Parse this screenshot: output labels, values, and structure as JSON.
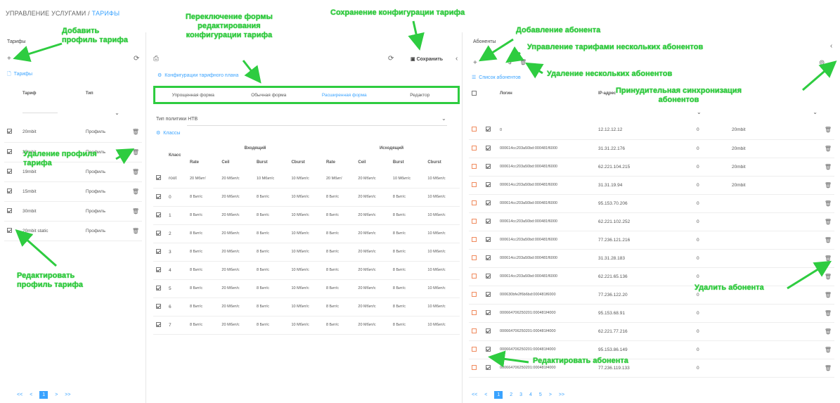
{
  "breadcrumb": {
    "root": "УПРАВЛЕНИЕ УСЛУГАМИ",
    "sep": " / ",
    "current": "ТАРИФЫ"
  },
  "left": {
    "title": "Тарифы",
    "section": "Тарифы",
    "columns": [
      "Тариф",
      "Тип"
    ],
    "rows": [
      {
        "name": "20mbit",
        "type": "Профиль"
      },
      {
        "name": "25mbit",
        "type": "Профиль"
      },
      {
        "name": "19mbit",
        "type": "Профиль"
      },
      {
        "name": "15mbit",
        "type": "Профиль"
      },
      {
        "name": "30mbit",
        "type": "Профиль"
      },
      {
        "name": "20mbit static",
        "type": "Профиль"
      }
    ],
    "pager": [
      "<<",
      "<",
      "1",
      ">",
      ">>"
    ]
  },
  "middle": {
    "save_label": "Сохранить",
    "config_section": "Конфигурации тарифного плана",
    "tabs": [
      {
        "label": "Упрощенная форма",
        "active": false
      },
      {
        "label": "Обычная форма",
        "active": false
      },
      {
        "label": "Расширенная форма",
        "active": true
      },
      {
        "label": "Редактор",
        "active": false
      }
    ],
    "policy_label": "Тип политики",
    "policy_value": "HTB",
    "classes_section": "Классы",
    "col_class": "Класс",
    "col_incoming": "Входящий",
    "col_outgoing": "Исходящий",
    "subcols": [
      "Rate",
      "Ceil",
      "Burst",
      "Cburst",
      "Rate",
      "Ceil",
      "Burst",
      "Cburst"
    ],
    "rows": [
      {
        "cls": "root",
        "v": [
          "20 Мбит/",
          "20 Мбит/с",
          "10 Мбит/с",
          "10 Мбит/с",
          "20 Мбит/",
          "20 Мбит/с",
          "10 Мбит/с",
          "10 Мбит/с"
        ]
      },
      {
        "cls": "0",
        "v": [
          "8 Бит/с",
          "20 Мбит/с",
          "8 Бит/с",
          "10 Мбит/с",
          "8 Бит/с",
          "20 Мбит/с",
          "8 Бит/с",
          "10 Мбит/с"
        ]
      },
      {
        "cls": "1",
        "v": [
          "8 Бит/с",
          "20 Мбит/с",
          "8 Бит/с",
          "10 Мбит/с",
          "8 Бит/с",
          "20 Мбит/с",
          "8 Бит/с",
          "10 Мбит/с"
        ]
      },
      {
        "cls": "2",
        "v": [
          "8 Бит/с",
          "20 Мбит/с",
          "8 Бит/с",
          "10 Мбит/с",
          "8 Бит/с",
          "20 Мбит/с",
          "8 Бит/с",
          "10 Мбит/с"
        ]
      },
      {
        "cls": "3",
        "v": [
          "8 Бит/с",
          "20 Мбит/с",
          "8 Бит/с",
          "10 Мбит/с",
          "8 Бит/с",
          "20 Мбит/с",
          "8 Бит/с",
          "10 Мбит/с"
        ]
      },
      {
        "cls": "4",
        "v": [
          "8 Бит/с",
          "20 Мбит/с",
          "8 Бит/с",
          "10 Мбит/с",
          "8 Бит/с",
          "20 Мбит/с",
          "8 Бит/с",
          "10 Мбит/с"
        ]
      },
      {
        "cls": "5",
        "v": [
          "8 Бит/с",
          "20 Мбит/с",
          "8 Бит/с",
          "10 Мбит/с",
          "8 Бит/с",
          "20 Мбит/с",
          "8 Бит/с",
          "10 Мбит/с"
        ]
      },
      {
        "cls": "6",
        "v": [
          "8 Бит/с",
          "20 Мбит/с",
          "8 Бит/с",
          "10 Мбит/с",
          "8 Бит/с",
          "20 Мбит/с",
          "8 Бит/с",
          "10 Мбит/с"
        ]
      },
      {
        "cls": "7",
        "v": [
          "8 Бит/с",
          "20 Мбит/с",
          "8 Бит/с",
          "10 Мбит/с",
          "8 Бит/с",
          "20 Мбит/с",
          "8 Бит/с",
          "10 Мбит/с"
        ]
      }
    ]
  },
  "right": {
    "title": "Абоненты",
    "section": "Список абонентов",
    "col_login": "Логин",
    "col_ip": "IP-адрес",
    "rows": [
      {
        "login": "0",
        "ip": "12.12.12.12",
        "n": "0",
        "tariff": "20mbit"
      },
      {
        "login": "000614cc203a50bd:000481f6000",
        "ip": "31.31.22.176",
        "n": "0",
        "tariff": "20mbit"
      },
      {
        "login": "000614cc203a50bd:000481f6000",
        "ip": "62.221.104.215",
        "n": "0",
        "tariff": "20mbit"
      },
      {
        "login": "000614cc203a50bd:000481f6000",
        "ip": "31.31.19.94",
        "n": "0",
        "tariff": "20mbit"
      },
      {
        "login": "000614cc203a50bd:000481f6000",
        "ip": "95.153.70.206",
        "n": "0",
        "tariff": ""
      },
      {
        "login": "000614cc203a50bd:000481f6000",
        "ip": "62.221.102.252",
        "n": "0",
        "tariff": ""
      },
      {
        "login": "000614cc203a50bd:000481f6000",
        "ip": "77.236.121.216",
        "n": "0",
        "tariff": ""
      },
      {
        "login": "000614cc203a50bd:000481f6000",
        "ip": "31.31.28.183",
        "n": "0",
        "tariff": ""
      },
      {
        "login": "000614cc203a50bd:000481f6000",
        "ip": "62.221.65.136",
        "n": "0",
        "tariff": ""
      },
      {
        "login": "000630bfe2f6b6bd:000481f6000",
        "ip": "77.236.122.20",
        "n": "0",
        "tariff": ""
      },
      {
        "login": "000664706250201:000481f4000",
        "ip": "95.153.68.91",
        "n": "0",
        "tariff": ""
      },
      {
        "login": "000664706250201:000481f4000",
        "ip": "62.221.77.216",
        "n": "0",
        "tariff": ""
      },
      {
        "login": "000664706250201:000481f4000",
        "ip": "95.153.86.149",
        "n": "0",
        "tariff": ""
      },
      {
        "login": "000664706250201:000481f4000",
        "ip": "77.236.119.133",
        "n": "0",
        "tariff": ""
      }
    ],
    "pager": [
      "<<",
      "<",
      "1",
      "2",
      "3",
      "4",
      "5",
      ">",
      ">>"
    ]
  },
  "annotations": {
    "add_tariff": "Добавить\nпрофиль тарифа",
    "delete_tariff": "Удаление профиля\nтарифа",
    "edit_tariff": "Редактировать\nпрофиль тарифа",
    "switch_form": "Переключение формы\nредактирования\nконфигурации тарифа",
    "save_config": "Сохранение конфигурации тарифа",
    "add_subscriber": "Добавление абонента",
    "manage_tariffs": "Управление тарифами нескольких абонентов",
    "delete_multi": "Удаление нескольких абонентов",
    "force_sync": "Принудительная синхронизация\nабонентов",
    "delete_subscriber": "Удалить абонента",
    "edit_subscriber": "Редактировать абонента"
  },
  "colors": {
    "annotation": "#2ecc40",
    "accent": "#3aa3ff",
    "checkbox_red": "#f08a5d"
  }
}
